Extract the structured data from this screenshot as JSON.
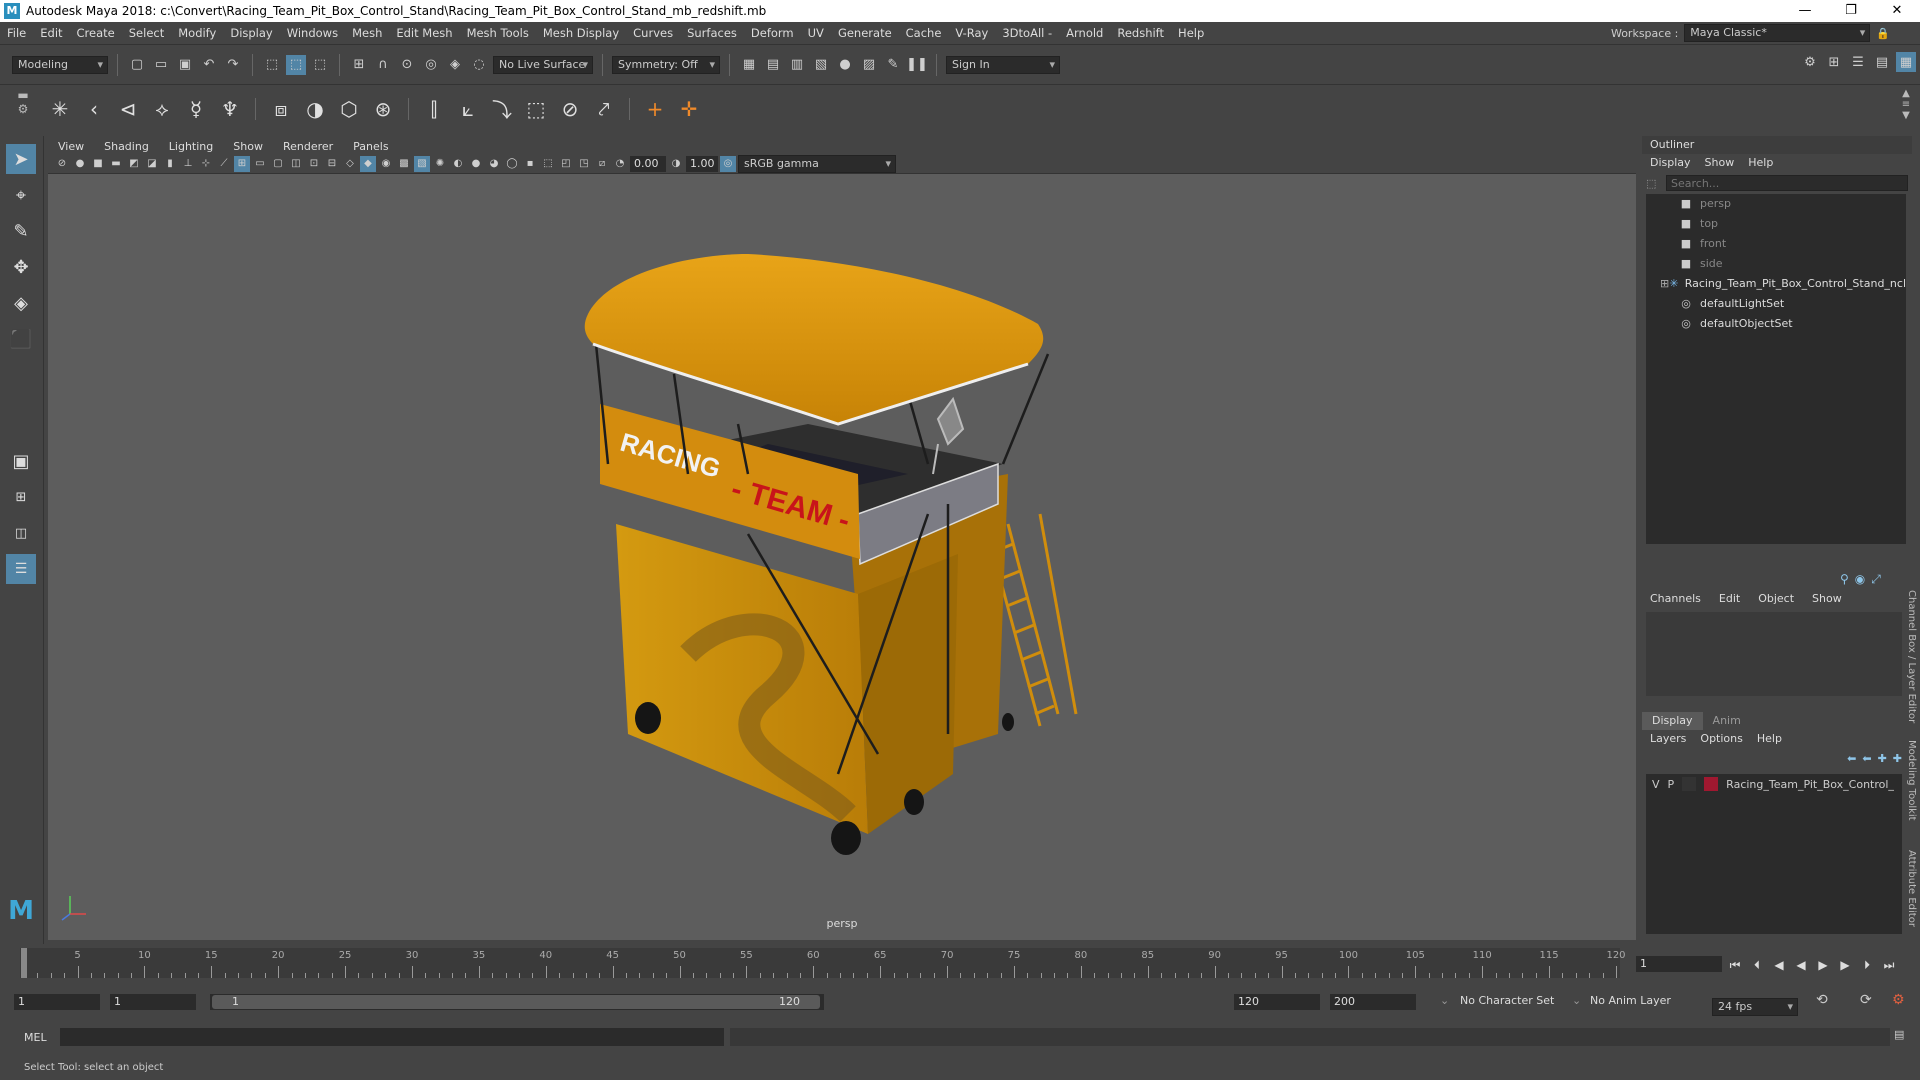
{
  "window": {
    "title": "Autodesk Maya 2018: c:\\Convert\\Racing_Team_Pit_Box_Control_Stand\\Racing_Team_Pit_Box_Control_Stand_mb_redshift.mb",
    "minimize": "—",
    "maximize": "❐",
    "close": "✕"
  },
  "menubar": {
    "items": [
      "File",
      "Edit",
      "Create",
      "Select",
      "Modify",
      "Display",
      "Windows",
      "Mesh",
      "Edit Mesh",
      "Mesh Tools",
      "Mesh Display",
      "Curves",
      "Surfaces",
      "Deform",
      "UV",
      "Generate",
      "Cache",
      "V-Ray",
      "3DtoAll -",
      "Arnold",
      "Redshift",
      "Help"
    ],
    "workspace_label": "Workspace :",
    "workspace_value": "Maya Classic*"
  },
  "statusline": {
    "mode": "Modeling",
    "live_surface": "No Live Surface",
    "symmetry": "Symmetry: Off",
    "sign_in": "Sign In"
  },
  "panel": {
    "menu": [
      "View",
      "Shading",
      "Lighting",
      "Show",
      "Renderer",
      "Panels"
    ],
    "exposure": "0.00",
    "gamma": "1.00",
    "colorspace": "sRGB gamma",
    "camera_label": "persp"
  },
  "model": {
    "sign_top": "RACING",
    "sign_bottom": "- TEAM -"
  },
  "outliner": {
    "title": "Outliner",
    "menu": [
      "Display",
      "Show",
      "Help"
    ],
    "search_placeholder": "Search...",
    "items": [
      {
        "label": "persp",
        "icon": "camera-icon",
        "dim": true
      },
      {
        "label": "top",
        "icon": "camera-icon",
        "dim": true
      },
      {
        "label": "front",
        "icon": "camera-icon",
        "dim": true
      },
      {
        "label": "side",
        "icon": "camera-icon",
        "dim": true
      },
      {
        "label": "Racing_Team_Pit_Box_Control_Stand_ncl",
        "icon": "group-icon",
        "dim": false
      },
      {
        "label": "defaultLightSet",
        "icon": "set-icon",
        "dim": false
      },
      {
        "label": "defaultObjectSet",
        "icon": "set-icon",
        "dim": false
      }
    ]
  },
  "channelbox": {
    "menu": [
      "Channels",
      "Edit",
      "Object",
      "Show"
    ]
  },
  "layers": {
    "tabs": [
      "Display",
      "Anim"
    ],
    "menu": [
      "Layers",
      "Options",
      "Help"
    ],
    "row": {
      "v": "V",
      "p": "P",
      "name": "Racing_Team_Pit_Box_Control_",
      "color": "#a01830"
    }
  },
  "sidetabs": [
    "Channel Box / Layer Editor",
    "Modeling Toolkit",
    "Attribute Editor"
  ],
  "timeslider": {
    "labels": [
      "5",
      "10",
      "15",
      "20",
      "25",
      "30",
      "35",
      "40",
      "45",
      "50",
      "55",
      "60",
      "65",
      "70",
      "75",
      "80",
      "85",
      "90",
      "95",
      "100",
      "105",
      "110",
      "115",
      "120"
    ],
    "first_frame": "1",
    "current_frame": "1"
  },
  "range": {
    "start": "1",
    "anim_start": "1",
    "range_start": "1",
    "range_end": "120",
    "end": "120",
    "anim_end": "200",
    "character_set": "No Character Set",
    "anim_layer": "No Anim Layer",
    "fps": "24 fps"
  },
  "cmdline": {
    "label": "MEL"
  },
  "helpline": {
    "text": "Select Tool: select an object"
  }
}
